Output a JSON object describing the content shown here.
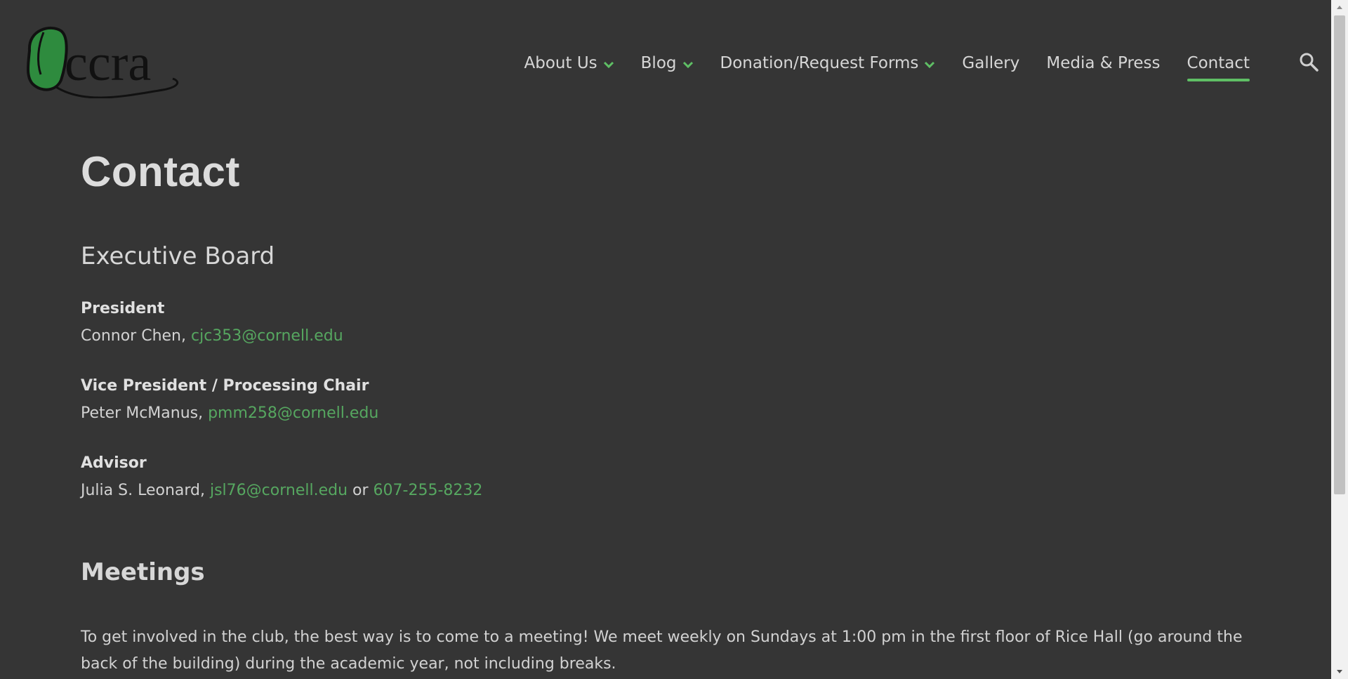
{
  "header": {
    "logo_text": "ccra",
    "nav": [
      {
        "label": "About Us",
        "dropdown": true
      },
      {
        "label": "Blog",
        "dropdown": true
      },
      {
        "label": "Donation/Request Forms",
        "dropdown": true
      },
      {
        "label": "Gallery",
        "dropdown": false
      },
      {
        "label": "Media & Press",
        "dropdown": false
      },
      {
        "label": "Contact",
        "dropdown": false,
        "active": true
      }
    ],
    "search_icon": "search-icon"
  },
  "main": {
    "title": "Contact",
    "exec_title": "Executive Board",
    "members": [
      {
        "role": "President",
        "name": "Connor Chen, ",
        "email": "cjc353@cornell.edu"
      },
      {
        "role": "Vice President / Processing Chair",
        "name": "Peter McManus, ",
        "email": "pmm258@cornell.edu"
      },
      {
        "role": "Advisor",
        "name": "Julia S. Leonard, ",
        "email": "jsl76@cornell.edu",
        "or": " or ",
        "phone": "607-255-8232"
      }
    ],
    "meetings_title": "Meetings",
    "meetings_text": "To get involved in the club, the best way is to come to a meeting!  We meet weekly on Sundays at 1:00 pm in the first floor of Rice Hall (go around the back of the building) during the academic year, not including breaks."
  },
  "colors": {
    "background": "#353535",
    "accent": "#5fbf65",
    "link": "#56a760",
    "logo_green": "#2e8b3e"
  }
}
